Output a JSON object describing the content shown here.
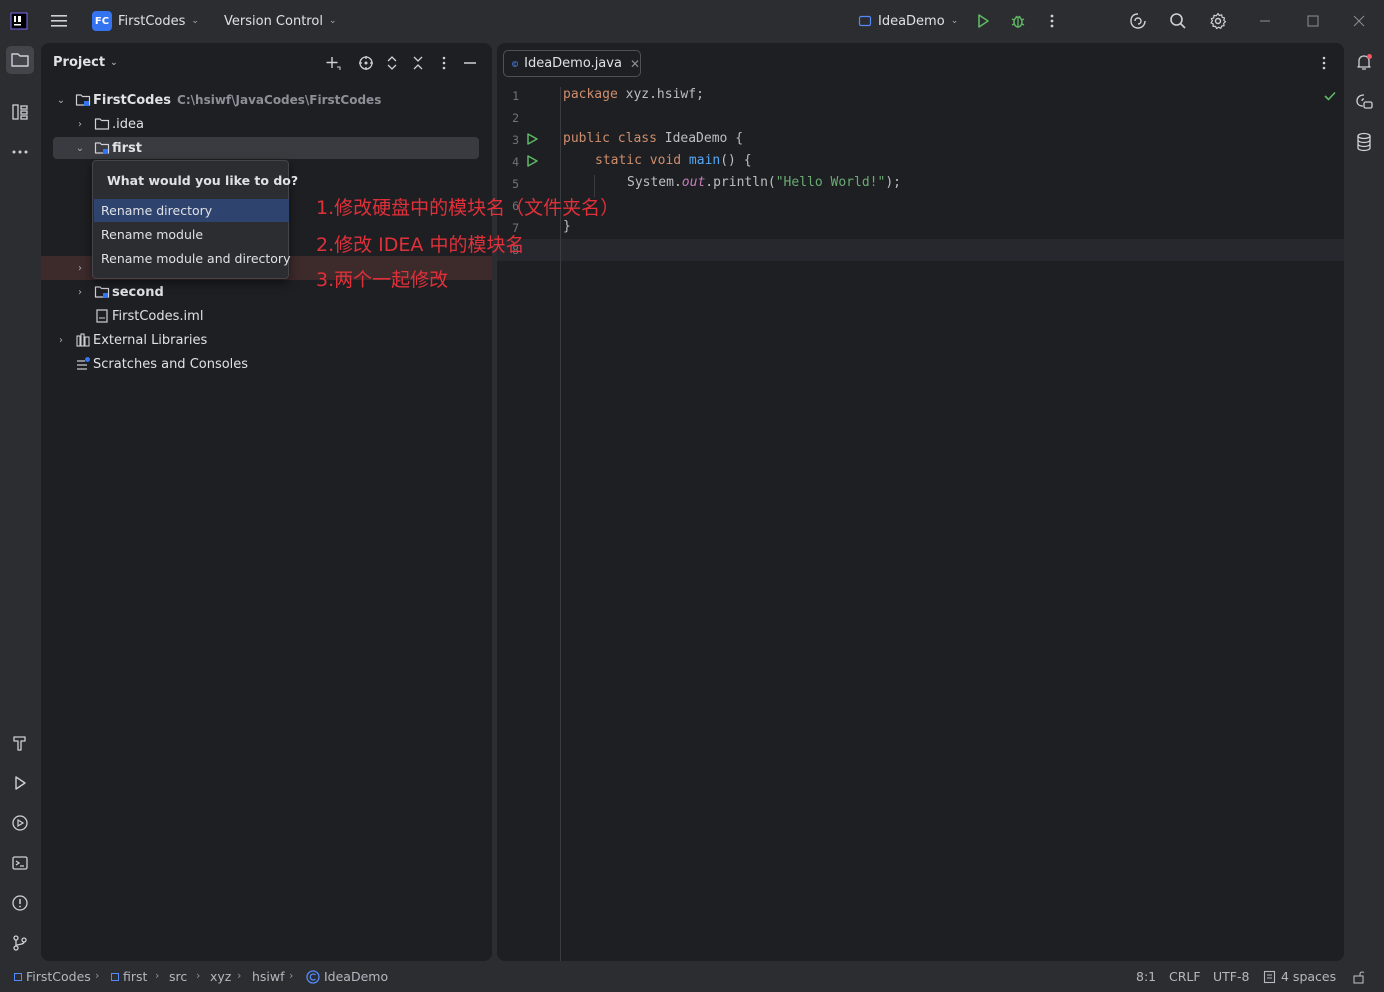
{
  "titlebar": {
    "project_badge": "FC",
    "project_name": "FirstCodes",
    "vcs_label": "Version Control",
    "run_config": "IdeaDemo"
  },
  "project_panel": {
    "title": "Project",
    "tree": [
      {
        "label": "FirstCodes",
        "path": "C:\\hsiwf\\JavaCodes\\FirstCodes"
      },
      {
        "label": ".idea"
      },
      {
        "label": "first"
      },
      {
        "label": "second"
      },
      {
        "label": "FirstCodes.iml"
      },
      {
        "label": "External Libraries"
      },
      {
        "label": "Scratches and Consoles"
      }
    ]
  },
  "popup": {
    "title": "What would you like to do?",
    "items": [
      "Rename directory",
      "Rename module",
      "Rename module and directory"
    ],
    "selected_index": 0
  },
  "annotations": [
    "1.修改硬盘中的模块名（文件夹名）",
    "2.修改 IDEA 中的模块名",
    "3.两个一起修改"
  ],
  "editor": {
    "tab_label": "IdeaDemo.java",
    "line_numbers": [
      "1",
      "2",
      "3",
      "4",
      "5",
      "6",
      "7",
      "8"
    ],
    "code": {
      "l1_kw": "package",
      "l1_rest": " xyz.hsiwf;",
      "l3_kw": "public class",
      "l3_rest": " IdeaDemo {",
      "l4_kw": "static void",
      "l4_fn": "main",
      "l4_rest": "() {",
      "l5_a": "System.",
      "l5_it": "out",
      "l5_b": ".println(",
      "l5_str": "\"Hello World!\"",
      "l5_c": ");",
      "l6": "}"
    }
  },
  "statusbar": {
    "breadcrumbs": [
      "FirstCodes",
      "first",
      "src",
      "xyz",
      "hsiwf",
      "IdeaDemo"
    ],
    "caret_pos": "8:1",
    "line_sep": "CRLF",
    "encoding": "UTF-8",
    "indent": "4 spaces"
  },
  "colors": {
    "accent": "#3574f0",
    "popup_selected": "#2e436e",
    "annotation_red": "#e0303a",
    "run_green": "#5fb865"
  }
}
